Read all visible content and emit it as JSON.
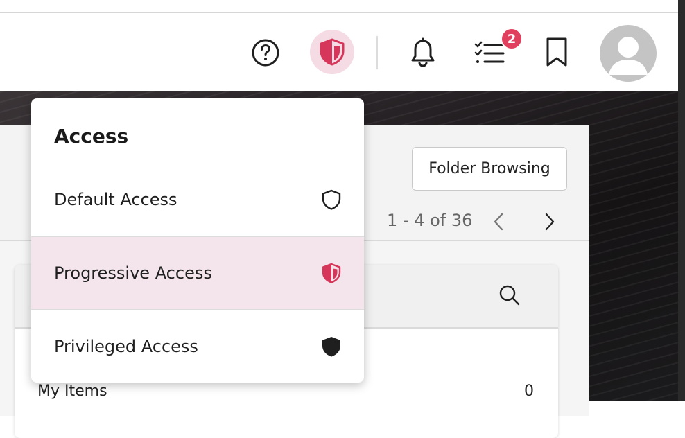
{
  "header": {
    "help_icon": "question-circle-icon",
    "access_icon": "half-shield-icon",
    "notifications_icon": "bell-icon",
    "tasks_icon": "checklist-icon",
    "tasks_badge": "2",
    "bookmark_icon": "bookmark-icon",
    "avatar_icon": "user-avatar-icon"
  },
  "access_menu": {
    "title": "Access",
    "items": [
      {
        "label": "Default Access",
        "icon": "shield-outline-icon",
        "selected": false
      },
      {
        "label": "Progressive Access",
        "icon": "half-shield-icon",
        "selected": true
      },
      {
        "label": "Privileged Access",
        "icon": "shield-filled-icon",
        "selected": false
      }
    ]
  },
  "panel": {
    "folder_browsing_label": "Folder Browsing",
    "pager_text": "1 - 4 of 36"
  },
  "card": {
    "my_items_label": "My Items",
    "my_items_count": "0"
  },
  "colors": {
    "accent": "#d6365a",
    "accent_light": "#f5dbe4",
    "selected_row": "#f4e4ec",
    "badge": "#e0405e"
  }
}
